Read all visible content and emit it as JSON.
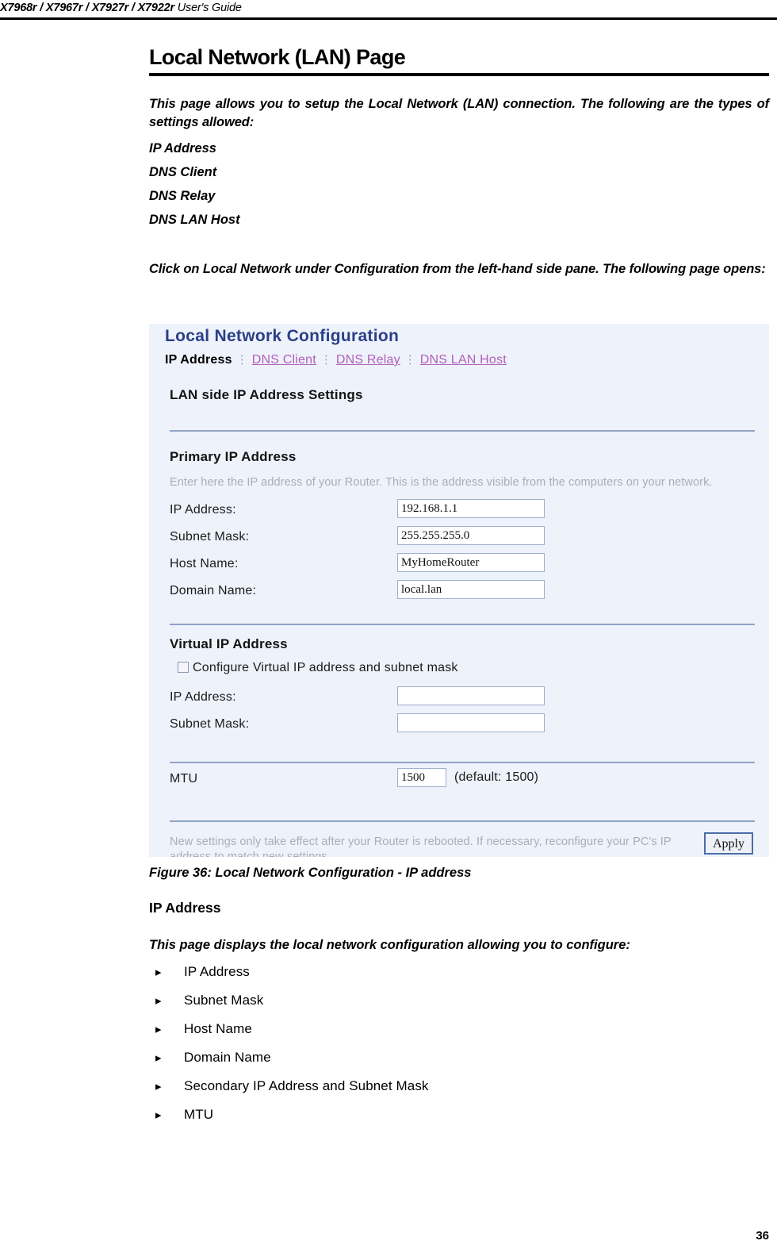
{
  "header": {
    "models": "X7968r / X7967r / X7927r / X7922r",
    "guide_label": " User's Guide"
  },
  "page_title": "Local Network (LAN) Page",
  "intro_paragraph": "This page allows you to setup the Local Network (LAN) connection. The following are the types of settings allowed:",
  "setting_types": [
    "IP Address",
    "DNS Client",
    "DNS Relay",
    "DNS LAN Host"
  ],
  "click_paragraph": "Click on Local Network under Configuration from the left-hand side pane. The following page opens:",
  "screenshot": {
    "title": "Local Network Configuration",
    "tabs": {
      "active": "IP Address",
      "separator": "⋮",
      "links": [
        "DNS Client",
        "DNS Relay",
        "DNS LAN Host"
      ]
    },
    "lan_section_heading": "LAN side IP Address Settings",
    "primary": {
      "heading": "Primary IP Address",
      "hint": "Enter here the IP address of your Router. This is the address visible from the computers on your network.",
      "fields": [
        {
          "label": "IP Address:",
          "value": "192.168.1.1"
        },
        {
          "label": "Subnet Mask:",
          "value": "255.255.255.0"
        },
        {
          "label": "Host Name:",
          "value": "MyHomeRouter"
        },
        {
          "label": "Domain Name:",
          "value": "local.lan"
        }
      ]
    },
    "virtual": {
      "heading": "Virtual IP Address",
      "checkbox_label": "Configure Virtual IP address and subnet mask",
      "checkbox_checked": false,
      "fields": [
        {
          "label": "IP Address:",
          "value": ""
        },
        {
          "label": "Subnet Mask:",
          "value": ""
        }
      ]
    },
    "mtu": {
      "label": "MTU",
      "value": "1500",
      "default_note": "(default: 1500)"
    },
    "footnote": "New settings only take effect after your Router is rebooted. If necessary, reconfigure your PC's IP address to match new settings.",
    "apply_label": "Apply",
    "colors": {
      "panel_background": "#eef2fa",
      "title_blue": "#2a3f87",
      "tab_link_purple": "#b05fb8",
      "separator_blue": "#8fa3c6",
      "hint_gray": "#a9aeb8",
      "button_border_blue": "#4b6ea9"
    }
  },
  "figure_caption": "Figure 36: Local Network Configuration - IP address",
  "sub_heading": "IP Address",
  "displays_paragraph": "This page displays the local network configuration allowing you to configure:",
  "bullet_marker": "▸",
  "bullets": [
    "IP Address",
    "Subnet Mask",
    "Host Name",
    "Domain Name",
    "Secondary IP Address and Subnet Mask",
    "MTU"
  ],
  "page_number": "36"
}
